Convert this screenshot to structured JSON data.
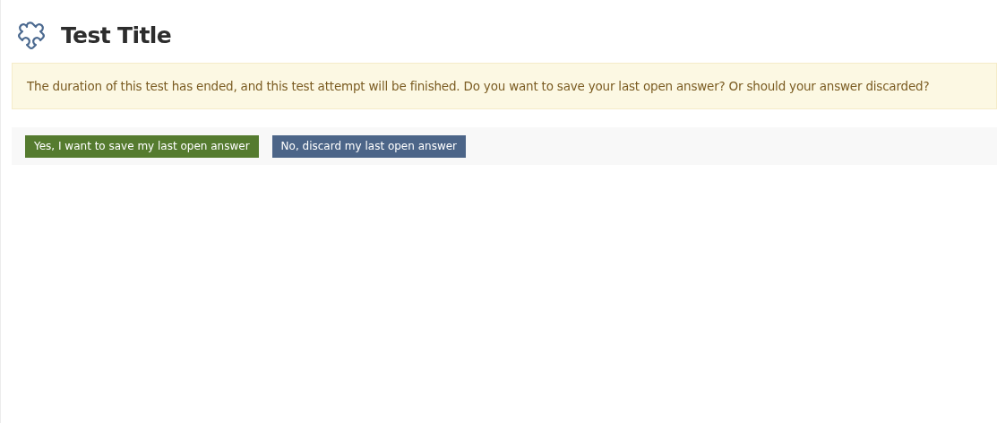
{
  "title": "Test Title",
  "message": "The duration of this test has ended, and this test attempt will be finished. Do you want to save your last open answer? Or should your answer discarded?",
  "buttons": [
    {
      "label": "Yes, I want to save my last open answer",
      "kind": "primary"
    },
    {
      "label": "No, discard my last open answer",
      "kind": "secondary"
    }
  ]
}
